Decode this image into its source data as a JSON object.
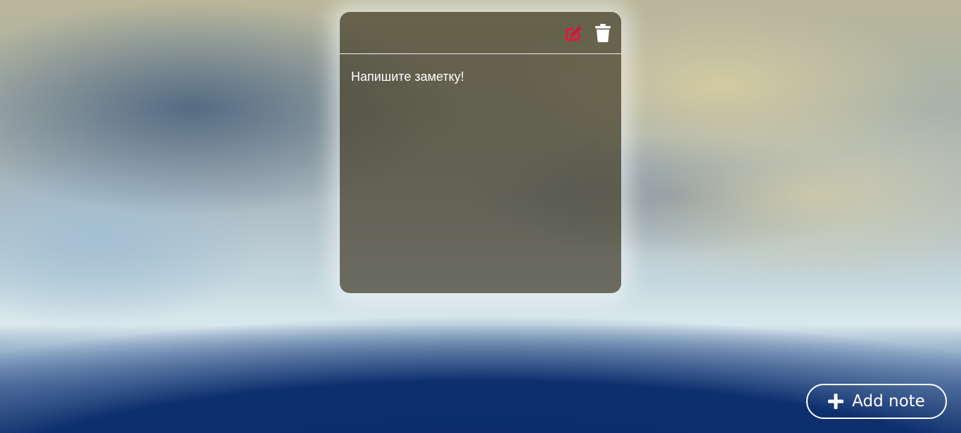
{
  "note": {
    "text": "Напишите заметку!",
    "tools": {
      "edit_icon": "edit-icon",
      "delete_icon": "trash-icon"
    }
  },
  "add_note": {
    "label": "Add note",
    "icon": "plus-icon"
  },
  "colors": {
    "edit_accent": "#e4163c",
    "white": "#ffffff"
  }
}
